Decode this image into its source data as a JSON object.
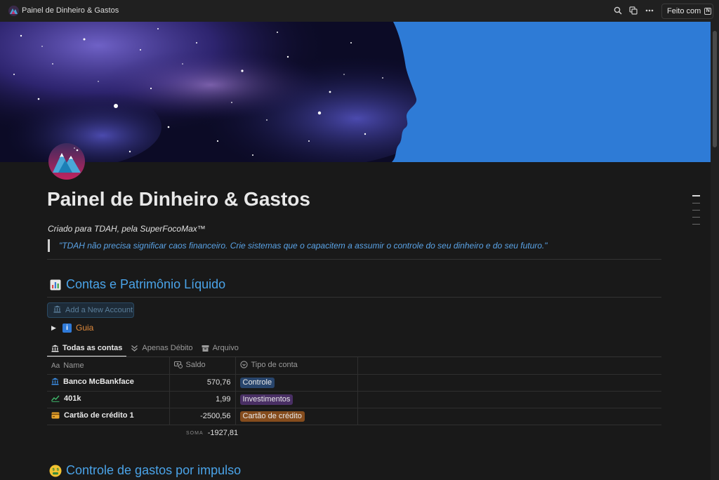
{
  "window": {
    "title": "Painel de Dinheiro & Gastos",
    "share_label": "Feito com",
    "share_logo": "N"
  },
  "page": {
    "title": "Painel de Dinheiro & Gastos",
    "subtitle": "Criado para TDAH, pela SuperFocoMax™",
    "quote": "\"TDAH não precisa significar caos financeiro. Crie sistemas que o capacitem a assumir o controle do seu dinheiro e do seu futuro.\""
  },
  "sections": {
    "accounts_title": "Contas e Patrimônio Líquido",
    "accounts_icon": "bar-chart-icon",
    "impulse_title": "Controle de gastos por impulso",
    "impulse_icon": "money-mouth-face-icon"
  },
  "accounts": {
    "add_button": "Add a New Account",
    "guide_toggle": "Guia",
    "tabs": [
      {
        "label": "Todas as contas",
        "icon": "bank-icon",
        "active": true
      },
      {
        "label": "Apenas Débito",
        "icon": "double-chevron-down-icon",
        "active": false
      },
      {
        "label": "Arquivo",
        "icon": "archive-icon",
        "active": false
      }
    ],
    "columns": {
      "name": "Name",
      "balance": "Saldo",
      "type": "Tipo de conta"
    },
    "rows": [
      {
        "name": "Banco McBankface",
        "icon": "bank-icon",
        "balance": "570,76",
        "type": "Controle",
        "type_color": "#28456c"
      },
      {
        "name": "401k",
        "icon": "chart-up-icon",
        "balance": "1,99",
        "type": "Investimentos",
        "type_color": "#492f64"
      },
      {
        "name": "Cartão de crédito 1",
        "icon": "credit-card-icon",
        "balance": "-2500,56",
        "type": "Cartão de crédito",
        "type_color": "#854c1d"
      }
    ],
    "sum_label": "SOMA",
    "sum_value": "-1927,81"
  },
  "colors": {
    "background": "#191919",
    "heading_blue": "#4aa3e8",
    "cover_blue": "#2e7bd6",
    "guide_orange": "#e08a3c"
  }
}
